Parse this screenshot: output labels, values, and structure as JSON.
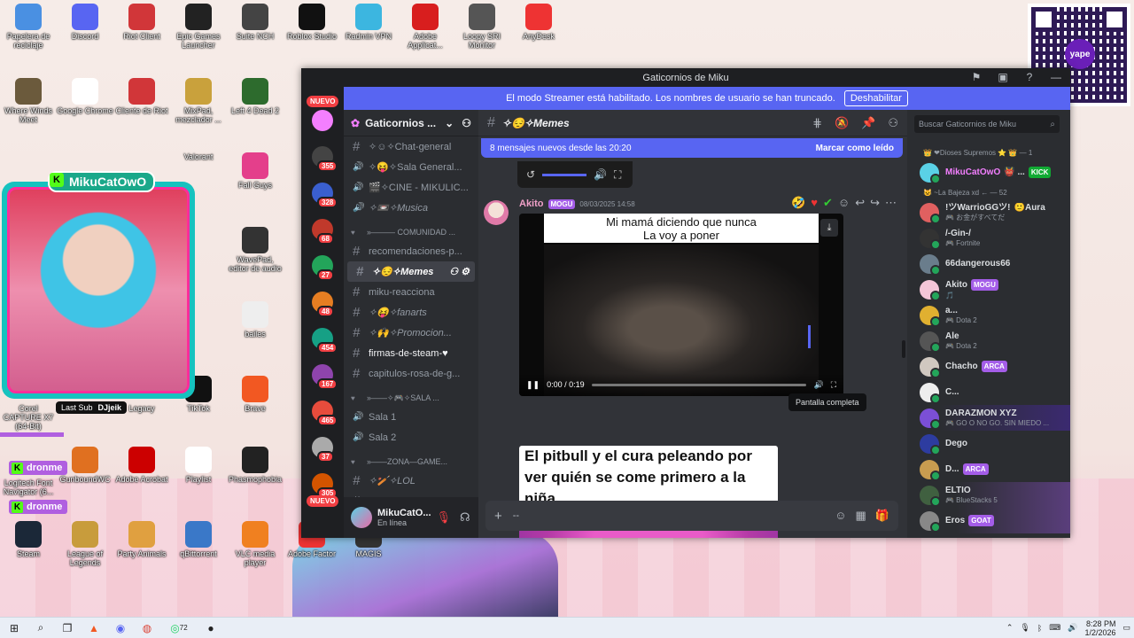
{
  "colors": {
    "discord_accent": "#5865f2",
    "kick_green": "#53fc18",
    "status_online": "#23a55a",
    "badge_red": "#f23f43"
  },
  "desktop": {
    "icons_row1": [
      "Papelera de reciclaje",
      "Discord",
      "Riot Client",
      "Epic Games Launcher",
      "Suite NCH",
      "Roblox Studio",
      "Radmin VPN",
      "Adobe Applicat...",
      "Loopy SRI Monitor",
      "AnyDesk"
    ],
    "icons_row2": [
      "Where Winds Meet",
      "Google Chrome",
      "Cliente de Riot",
      "MixPad, mezclador ...",
      "Left 4 Dead 2"
    ],
    "icons_col_misc": [
      "Fall Guys",
      "WavePad, editor de audio",
      "bailes",
      "TikTok",
      "Brave",
      "Playlist",
      "Phasmophobia",
      "Adobe Acrobat",
      "GunboundWC"
    ],
    "icons_row_bottom": [
      "Steam",
      "League of Legends",
      "Party Animals",
      "qBittorrent",
      "VLC media player",
      "Adobe Factor",
      "MAGIS"
    ],
    "partial_labels": [
      "Corel CAPTURE X7 (64-Bit)",
      "Legacy",
      "Valorant",
      "Logitech Font Navigator (6..."
    ]
  },
  "overlay": {
    "streamer_name": "MikuCatOwO",
    "last_sub_label": "Last Sub",
    "last_sub_user": "DJjeik",
    "kick_tags": [
      "dronme",
      "dronme"
    ],
    "qr_logo": "yape"
  },
  "discord": {
    "window_title": "Gaticornios de Miku",
    "streamer_banner": "El modo Streamer está habilitado. Los nombres de usuario se han truncado.",
    "streamer_disable": "Deshabilitar",
    "rail": {
      "badges": [
        "NUEVO",
        "355",
        "328",
        "68",
        "27",
        "48",
        "454",
        "167",
        "465",
        "37",
        "305",
        "NUEVO"
      ]
    },
    "server_name": "Gaticornios ...",
    "channels": [
      {
        "icon": "hash",
        "name": "✧☺✧Chat-general",
        "cls": ""
      },
      {
        "icon": "speaker",
        "name": "✧😝✧Sala General...",
        "cls": ""
      },
      {
        "icon": "speaker",
        "name": "🎬✧CINE - MIKULIC...",
        "cls": ""
      },
      {
        "icon": "speaker",
        "name": "✧📼✧Musica",
        "cls": "italic"
      },
      {
        "icon": "cat",
        "name": "»——— COMUNIDAD ...",
        "cls": "cat"
      },
      {
        "icon": "hash",
        "name": "recomendaciones-p...",
        "cls": ""
      },
      {
        "icon": "hash",
        "name": "✧😔✧Memes",
        "cls": "active"
      },
      {
        "icon": "hash",
        "name": "miku-reacciona",
        "cls": ""
      },
      {
        "icon": "hash",
        "name": "✧😝✧fanarts",
        "cls": "italic"
      },
      {
        "icon": "hash",
        "name": "✧🙌✧Promocion...",
        "cls": "italic"
      },
      {
        "icon": "hash",
        "name": "firmas-de-steam-♥",
        "cls": "bold"
      },
      {
        "icon": "hash",
        "name": "capitulos-rosa-de-g...",
        "cls": ""
      },
      {
        "icon": "cat",
        "name": "»——✧🎮✧Sala ...",
        "cls": "cat"
      },
      {
        "icon": "speaker",
        "name": "Sala 1",
        "cls": ""
      },
      {
        "icon": "speaker",
        "name": "Sala 2",
        "cls": ""
      },
      {
        "icon": "cat",
        "name": "»——ZONA—GAME...",
        "cls": "cat"
      },
      {
        "icon": "hash",
        "name": "✧🏏✧LOL",
        "cls": "italic"
      },
      {
        "icon": "hash",
        "name": "✧⚔✧Dota2",
        "cls": "bold italic"
      }
    ],
    "user": {
      "name": "MikuCatO...",
      "status": "En línea"
    },
    "channel_title": "✧😔✧Memes",
    "new_messages": "8 mensajes nuevos desde las 20:20",
    "mark_read": "Marcar como leído",
    "message": {
      "author": "Akito",
      "tag": "MOGU",
      "timestamp": "08/03/2025 14:58",
      "video_caption_1": "Mi mamá diciendo que nunca",
      "video_caption_2": "La voy a poner",
      "video_time": "0:00 / 0:19",
      "video_progress": 0,
      "tooltip": "Pantalla completa",
      "image_caption": "El pitbull y el cura peleando por ver quién se come primero a la niña"
    },
    "composer_placeholder": "--",
    "search_placeholder": "Buscar Gaticornios de Miku",
    "members": [
      {
        "type": "group",
        "label": "👑 ❤Dioses Supremos ⭐ 👑 — 1"
      },
      {
        "type": "member",
        "name": "MikuCatOwO",
        "extra": "👹 ...",
        "tag": "KICK",
        "status": "",
        "pink": true,
        "color": "#5ad1e6"
      },
      {
        "type": "group",
        "label": "😺 ~La Bajeza xd ← — 52"
      },
      {
        "type": "member",
        "name": "!ツWarrioGGツ!",
        "extra": "🙂Aura",
        "tag": "",
        "status": "🎮 お金がすべてだ",
        "color": "#e06060"
      },
      {
        "type": "member",
        "name": "/-Gin-/",
        "extra": "",
        "tag": "",
        "status": "🎮 Fortnite",
        "color": "#333"
      },
      {
        "type": "member",
        "name": "66dangerous66",
        "extra": "",
        "tag": "",
        "status": "",
        "color": "#6a7d8c"
      },
      {
        "type": "member",
        "name": "Akito",
        "extra": "",
        "tag": "MOGU",
        "status": "🎵",
        "color": "#f4c6d8"
      },
      {
        "type": "member",
        "name": "a...",
        "extra": "",
        "tag": "",
        "status": "🎮 Dota 2",
        "color": "#e0b030"
      },
      {
        "type": "member",
        "name": "Ale",
        "extra": "",
        "tag": "",
        "status": "🎮 Dota 2",
        "color": "#555"
      },
      {
        "type": "member",
        "name": "Chacho",
        "extra": "",
        "tag": "ARCA",
        "status": "",
        "color": "#d0c8c0"
      },
      {
        "type": "member",
        "name": "C...",
        "extra": "",
        "tag": "",
        "status": "",
        "color": "#eee"
      },
      {
        "type": "member",
        "name": "DARAZMON XYZ",
        "extra": "",
        "tag": "",
        "status": "🎮 GO O NO GO. SIN MIEDO ...",
        "color": "#7b4fd6",
        "hl": true
      },
      {
        "type": "member",
        "name": "Dego",
        "extra": "",
        "tag": "",
        "status": "",
        "color": "#2d3ca0"
      },
      {
        "type": "member",
        "name": "D...",
        "extra": "",
        "tag": "ARCA",
        "status": "",
        "color": "#c89c50"
      },
      {
        "type": "member",
        "name": "ELTIO",
        "extra": "",
        "tag": "",
        "status": "🎮 BlueStacks 5",
        "color": "#406040",
        "hl2": true
      },
      {
        "type": "member",
        "name": "Eros",
        "extra": "",
        "tag": "GOAT",
        "status": "",
        "color": "#888",
        "hl2": true
      }
    ]
  },
  "taskbar": {
    "time": "8:28 PM",
    "date": "1/2/2026",
    "badge_count": "72"
  }
}
